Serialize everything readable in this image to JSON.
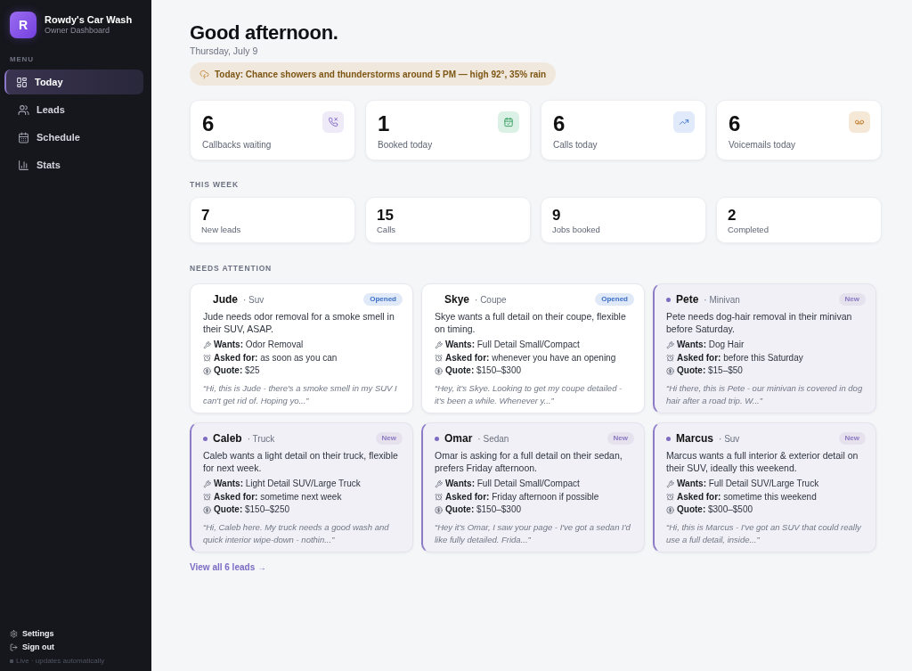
{
  "brand": {
    "initial": "R",
    "name": "Rowdy's Car Wash",
    "subtitle": "Owner Dashboard"
  },
  "sidebar": {
    "heading": "MENU",
    "items": [
      {
        "label": "Today",
        "selected": true
      },
      {
        "label": "Leads",
        "selected": false
      },
      {
        "label": "Schedule",
        "selected": false
      },
      {
        "label": "Stats",
        "selected": false
      }
    ],
    "footer_links": [
      "Settings",
      "Sign out"
    ],
    "status": "Live · updates automatically"
  },
  "header": {
    "greeting": "Good afternoon.",
    "date": "Thursday, July 9",
    "weather": "**Today:** Chance showers and thunderstorms around 5 PM — high 92°, 35% rain"
  },
  "today_stats": [
    {
      "value": "6",
      "label": "Callbacks waiting"
    },
    {
      "value": "1",
      "label": "Booked today"
    },
    {
      "value": "6",
      "label": "Calls today"
    },
    {
      "value": "6",
      "label": "Voicemails today"
    }
  ],
  "this_week": {
    "heading": "THIS WEEK",
    "stats": [
      {
        "value": "7",
        "label": "New leads"
      },
      {
        "value": "15",
        "label": "Calls"
      },
      {
        "value": "9",
        "label": "Jobs booked"
      },
      {
        "value": "2",
        "label": "Completed"
      }
    ]
  },
  "needs_attention": {
    "heading": "NEEDS ATTENTION",
    "leads": [
      {
        "name": "Jude",
        "vehicle": "· Suv",
        "status": "Opened",
        "unread": false,
        "summary": "Jude needs odor removal for a smoke smell in their SUV, ASAP.",
        "details": [
          "**Wants:** Odor Removal",
          "**Asked for:** as soon as you can",
          "**Quote:** $25"
        ],
        "message": "“Hi, this is Jude - there's a smoke smell in my SUV I can't get rid of. Hoping yo...”"
      },
      {
        "name": "Skye",
        "vehicle": "· Coupe",
        "status": "Opened",
        "unread": false,
        "summary": "Skye wants a full detail on their coupe, flexible on timing.",
        "details": [
          "**Wants:** Full Detail Small/Compact",
          "**Asked for:** whenever you have an opening",
          "**Quote:** $150–$300"
        ],
        "message": "“Hey, it's Skye. Looking to get my coupe detailed - it's been a while. Whenever y...”"
      },
      {
        "name": "Pete",
        "vehicle": "· Minivan",
        "status": "New",
        "unread": true,
        "summary": "Pete needs dog-hair removal in their minivan before Saturday.",
        "details": [
          "**Wants:** Dog Hair",
          "**Asked for:** before this Saturday",
          "**Quote:** $15–$50"
        ],
        "message": "“Hi there, this is Pete - our minivan is covered in dog hair after a road trip. W...”"
      },
      {
        "name": "Caleb",
        "vehicle": "· Truck",
        "status": "New",
        "unread": true,
        "summary": "Caleb wants a light detail on their truck, flexible for next week.",
        "details": [
          "**Wants:** Light Detail SUV/Large Truck",
          "**Asked for:** sometime next week",
          "**Quote:** $150–$250"
        ],
        "message": "“Hi, Caleb here. My truck needs a good wash and quick interior wipe-down - nothin...”"
      },
      {
        "name": "Omar",
        "vehicle": "· Sedan",
        "status": "New",
        "unread": true,
        "summary": "Omar is asking for a full detail on their sedan, prefers Friday afternoon.",
        "details": [
          "**Wants:** Full Detail Small/Compact",
          "**Asked for:** Friday afternoon if possible",
          "**Quote:** $150–$300"
        ],
        "message": "“Hey it's Omar, I saw your page - I've got a sedan I'd like fully detailed. Frida...”"
      },
      {
        "name": "Marcus",
        "vehicle": "· Suv",
        "status": "New",
        "unread": true,
        "summary": "Marcus wants a full interior & exterior detail on their SUV, ideally this weekend.",
        "details": [
          "**Wants:** Full Detail SUV/Large Truck",
          "**Asked for:** sometime this weekend",
          "**Quote:** $300–$500"
        ],
        "message": "“Hi, this is Marcus - I've got an SUV that could really use a full detail, inside...”"
      }
    ],
    "view_all": "View all 6 leads →"
  }
}
